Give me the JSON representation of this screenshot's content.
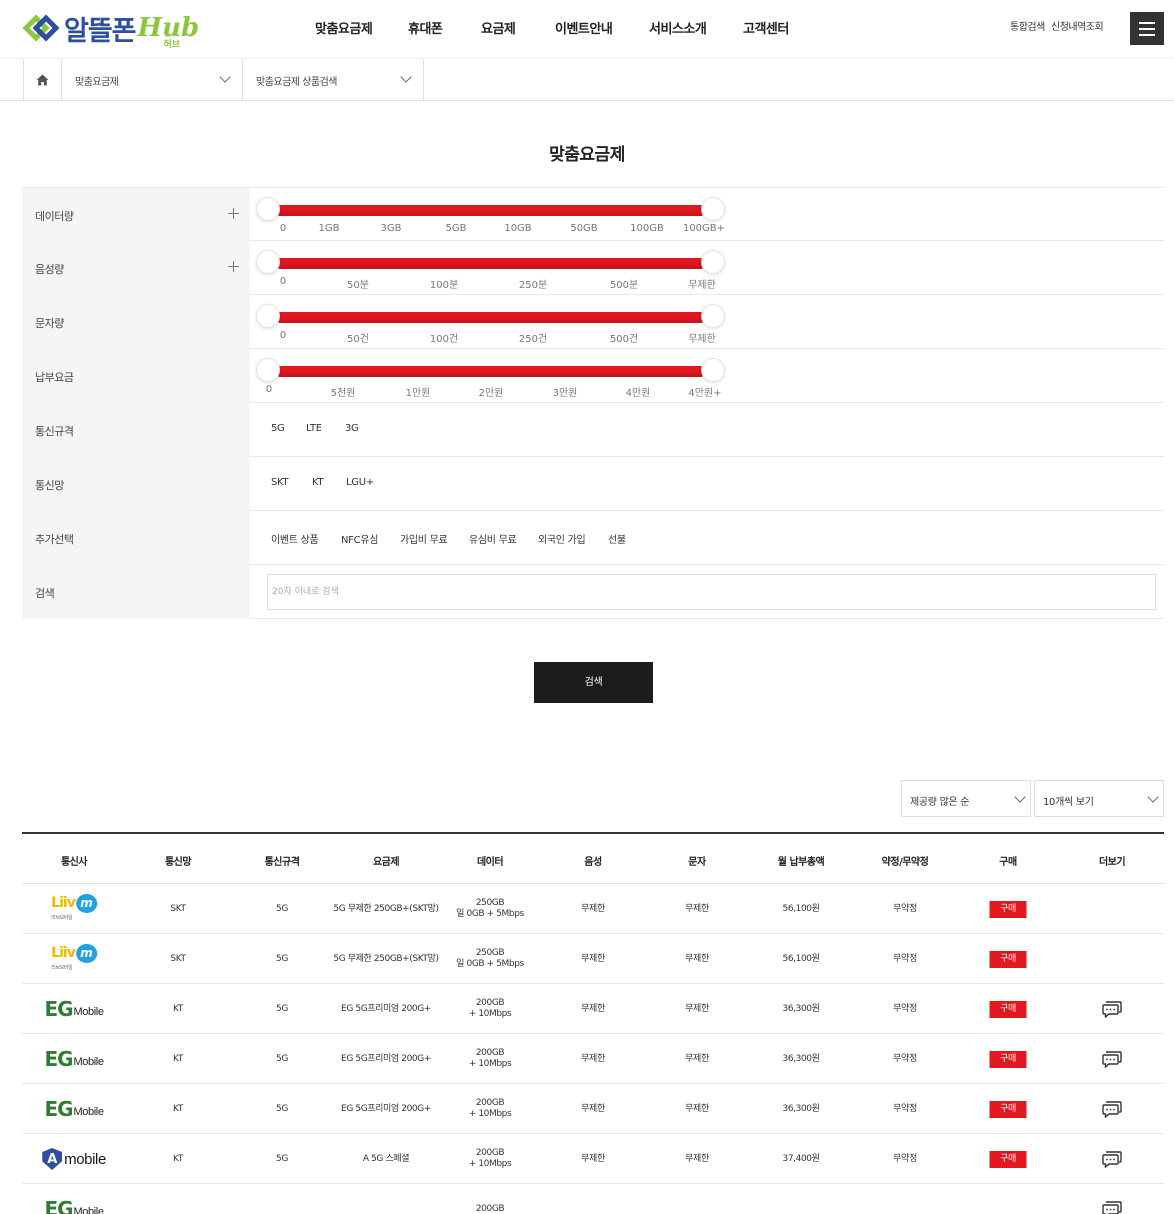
{
  "header": {
    "logo_text": "알뜰폰",
    "logo_hub": "Hub",
    "logo_sub": "허브",
    "nav": [
      "맞춤요금제",
      "휴대폰",
      "요금제",
      "이벤트안내",
      "서비스소개",
      "고객센터"
    ],
    "util": [
      "통합검색",
      "신청내역조회"
    ]
  },
  "breadcrumb": {
    "first": "맞춤요금제",
    "second": "맞춤요금제 상품검색"
  },
  "page_title": "맞춤요금제",
  "filters": {
    "data": {
      "label": "데이터량",
      "ticks": [
        "0",
        "1GB",
        "3GB",
        "5GB",
        "10GB",
        "50GB",
        "100GB",
        "100GB+"
      ]
    },
    "voice": {
      "label": "음성량",
      "ticks": [
        "0",
        "50분",
        "100분",
        "250분",
        "500분",
        "무제한"
      ]
    },
    "sms": {
      "label": "문자량",
      "ticks": [
        "0",
        "50건",
        "100건",
        "250건",
        "500건",
        "무제한"
      ]
    },
    "fee": {
      "label": "납부요금",
      "ticks": [
        "0",
        "5천원",
        "1만원",
        "2만원",
        "3만원",
        "4만원",
        "4만원+"
      ]
    },
    "spec": {
      "label": "통신규격",
      "options": [
        "5G",
        "LTE",
        "3G"
      ]
    },
    "network": {
      "label": "통신망",
      "options": [
        "SKT",
        "KT",
        "LGU+"
      ]
    },
    "extra": {
      "label": "추가선택",
      "options": [
        "이벤트 상품",
        "NFC유심",
        "가입비 무료",
        "유심비 무료",
        "외국인 가입",
        "선불"
      ]
    },
    "search": {
      "label": "검색",
      "placeholder": "20자 이내로 검색"
    }
  },
  "search_button": "검색",
  "sort": {
    "order": "제공량 많은 순",
    "page_size": "10개씩 보기"
  },
  "results": {
    "columns": [
      "통신사",
      "통신망",
      "통신규격",
      "요금제",
      "데이터",
      "음성",
      "문자",
      "월 납부총액",
      "약정/무약정",
      "구매",
      "더보기"
    ],
    "rows": [
      {
        "carrier": "liiv",
        "carrier_name": "Liiv",
        "carrier_sub": "리브모바일",
        "network": "SKT",
        "spec": "5G",
        "plan": "5G 무제한 250GB+(SKT망)",
        "data1": "250GB",
        "data2": "일 0GB + 5Mbps",
        "voice": "무제한",
        "sms": "무제한",
        "price": "56,100원",
        "contract": "무약정",
        "buy": "구매",
        "more": false
      },
      {
        "carrier": "liiv",
        "carrier_name": "Liiv",
        "carrier_sub": "리브모바일",
        "network": "SKT",
        "spec": "5G",
        "plan": "5G 무제한 250GB+(SKT망)",
        "data1": "250GB",
        "data2": "일 0GB + 5Mbps",
        "voice": "무제한",
        "sms": "무제한",
        "price": "56,100원",
        "contract": "무약정",
        "buy": "구매",
        "more": false
      },
      {
        "carrier": "eg",
        "carrier_name": "EG",
        "carrier_sub": "Mobile",
        "network": "KT",
        "spec": "5G",
        "plan": "EG 5G프리미엄 200G+",
        "data1": "200GB",
        "data2": "+ 10Mbps",
        "voice": "무제한",
        "sms": "무제한",
        "price": "36,300원",
        "contract": "무약정",
        "buy": "구매",
        "more": true
      },
      {
        "carrier": "eg",
        "carrier_name": "EG",
        "carrier_sub": "Mobile",
        "network": "KT",
        "spec": "5G",
        "plan": "EG 5G프리미엄 200G+",
        "data1": "200GB",
        "data2": "+ 10Mbps",
        "voice": "무제한",
        "sms": "무제한",
        "price": "36,300원",
        "contract": "무약정",
        "buy": "구매",
        "more": true
      },
      {
        "carrier": "eg",
        "carrier_name": "EG",
        "carrier_sub": "Mobile",
        "network": "KT",
        "spec": "5G",
        "plan": "EG 5G프리미엄 200G+",
        "data1": "200GB",
        "data2": "+ 10Mbps",
        "voice": "무제한",
        "sms": "무제한",
        "price": "36,300원",
        "contract": "무약정",
        "buy": "구매",
        "more": true
      },
      {
        "carrier": "a",
        "carrier_name": "A",
        "carrier_sub": "mobile",
        "network": "KT",
        "spec": "5G",
        "plan": "A 5G 스페셜",
        "data1": "200GB",
        "data2": "+ 10Mbps",
        "voice": "무제한",
        "sms": "무제한",
        "price": "37,400원",
        "contract": "무약정",
        "buy": "구매",
        "more": true
      },
      {
        "carrier": "eg",
        "carrier_name": "EG",
        "carrier_sub": "Mobile",
        "network": "",
        "spec": "",
        "plan": "",
        "data1": "200GB",
        "data2": "",
        "voice": "",
        "sms": "",
        "price": "",
        "contract": "",
        "buy": "",
        "more": true
      }
    ]
  },
  "colors": {
    "accent": "#e2171f",
    "brand_blue": "#2d4fa0",
    "brand_green": "#8cc63f",
    "dark": "#1c1c1c"
  },
  "icons": {
    "home": "home-icon",
    "menu": "hamburger-menu-icon",
    "more": "chat-bubbles-icon",
    "chevron": "chevron-down-icon",
    "plus": "plus-icon"
  }
}
